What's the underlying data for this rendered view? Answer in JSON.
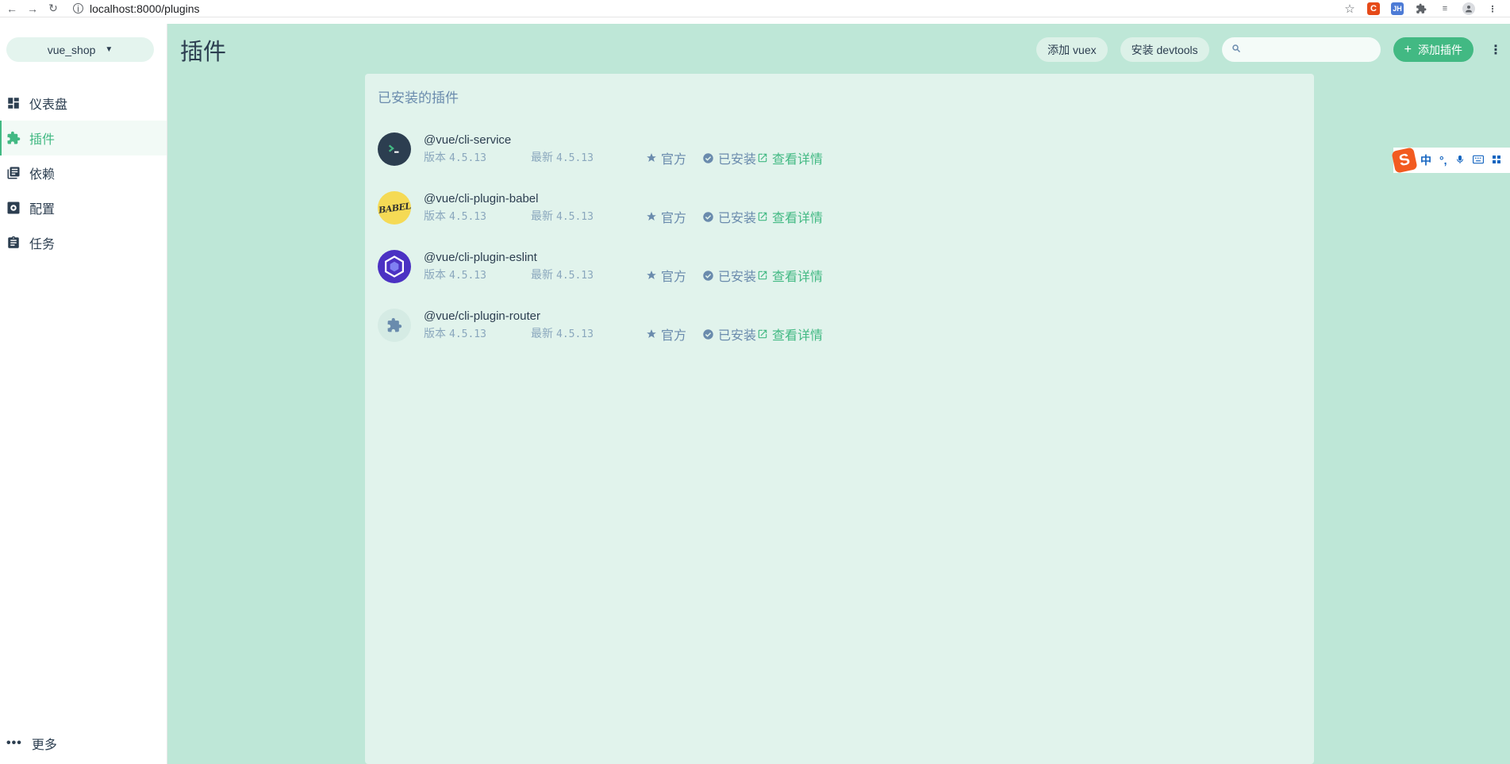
{
  "browser": {
    "url": "localhost:8000/plugins"
  },
  "sidebar": {
    "project": "vue_shop",
    "items": [
      {
        "label": "仪表盘",
        "icon": "dashboard-icon",
        "active": false
      },
      {
        "label": "插件",
        "icon": "puzzle-icon",
        "active": true
      },
      {
        "label": "依赖",
        "icon": "library-books-icon",
        "active": false
      },
      {
        "label": "配置",
        "icon": "settings-applications-icon",
        "active": false
      },
      {
        "label": "任务",
        "icon": "assignment-icon",
        "active": false
      }
    ],
    "more_label": "更多"
  },
  "header": {
    "title": "插件",
    "add_vuex": "添加 vuex",
    "install_devtools": "安装 devtools",
    "search_placeholder": "",
    "add_plugin": "添加插件"
  },
  "panel": {
    "title": "已安装的插件",
    "version_label": "版本",
    "latest_label": "最新",
    "official_label": "官方",
    "installed_label": "已安装",
    "details_label": "查看详情",
    "plugins": [
      {
        "name": "@vue/cli-service",
        "version": "4.5.13",
        "latest": "4.5.13",
        "logo": "terminal-logo"
      },
      {
        "name": "@vue/cli-plugin-babel",
        "version": "4.5.13",
        "latest": "4.5.13",
        "logo": "babel-logo",
        "logo_text": "BABEL"
      },
      {
        "name": "@vue/cli-plugin-eslint",
        "version": "4.5.13",
        "latest": "4.5.13",
        "logo": "eslint-logo"
      },
      {
        "name": "@vue/cli-plugin-router",
        "version": "4.5.13",
        "latest": "4.5.13",
        "logo": "puzzle-logo"
      }
    ]
  },
  "ime": {
    "items": [
      "中",
      "°,"
    ]
  },
  "colors": {
    "accent": "#42b983",
    "main_bg": "#bee7d7",
    "panel_bg": "#e1f3ec",
    "text": "#2c3e50",
    "muted": "#6a8bad"
  }
}
